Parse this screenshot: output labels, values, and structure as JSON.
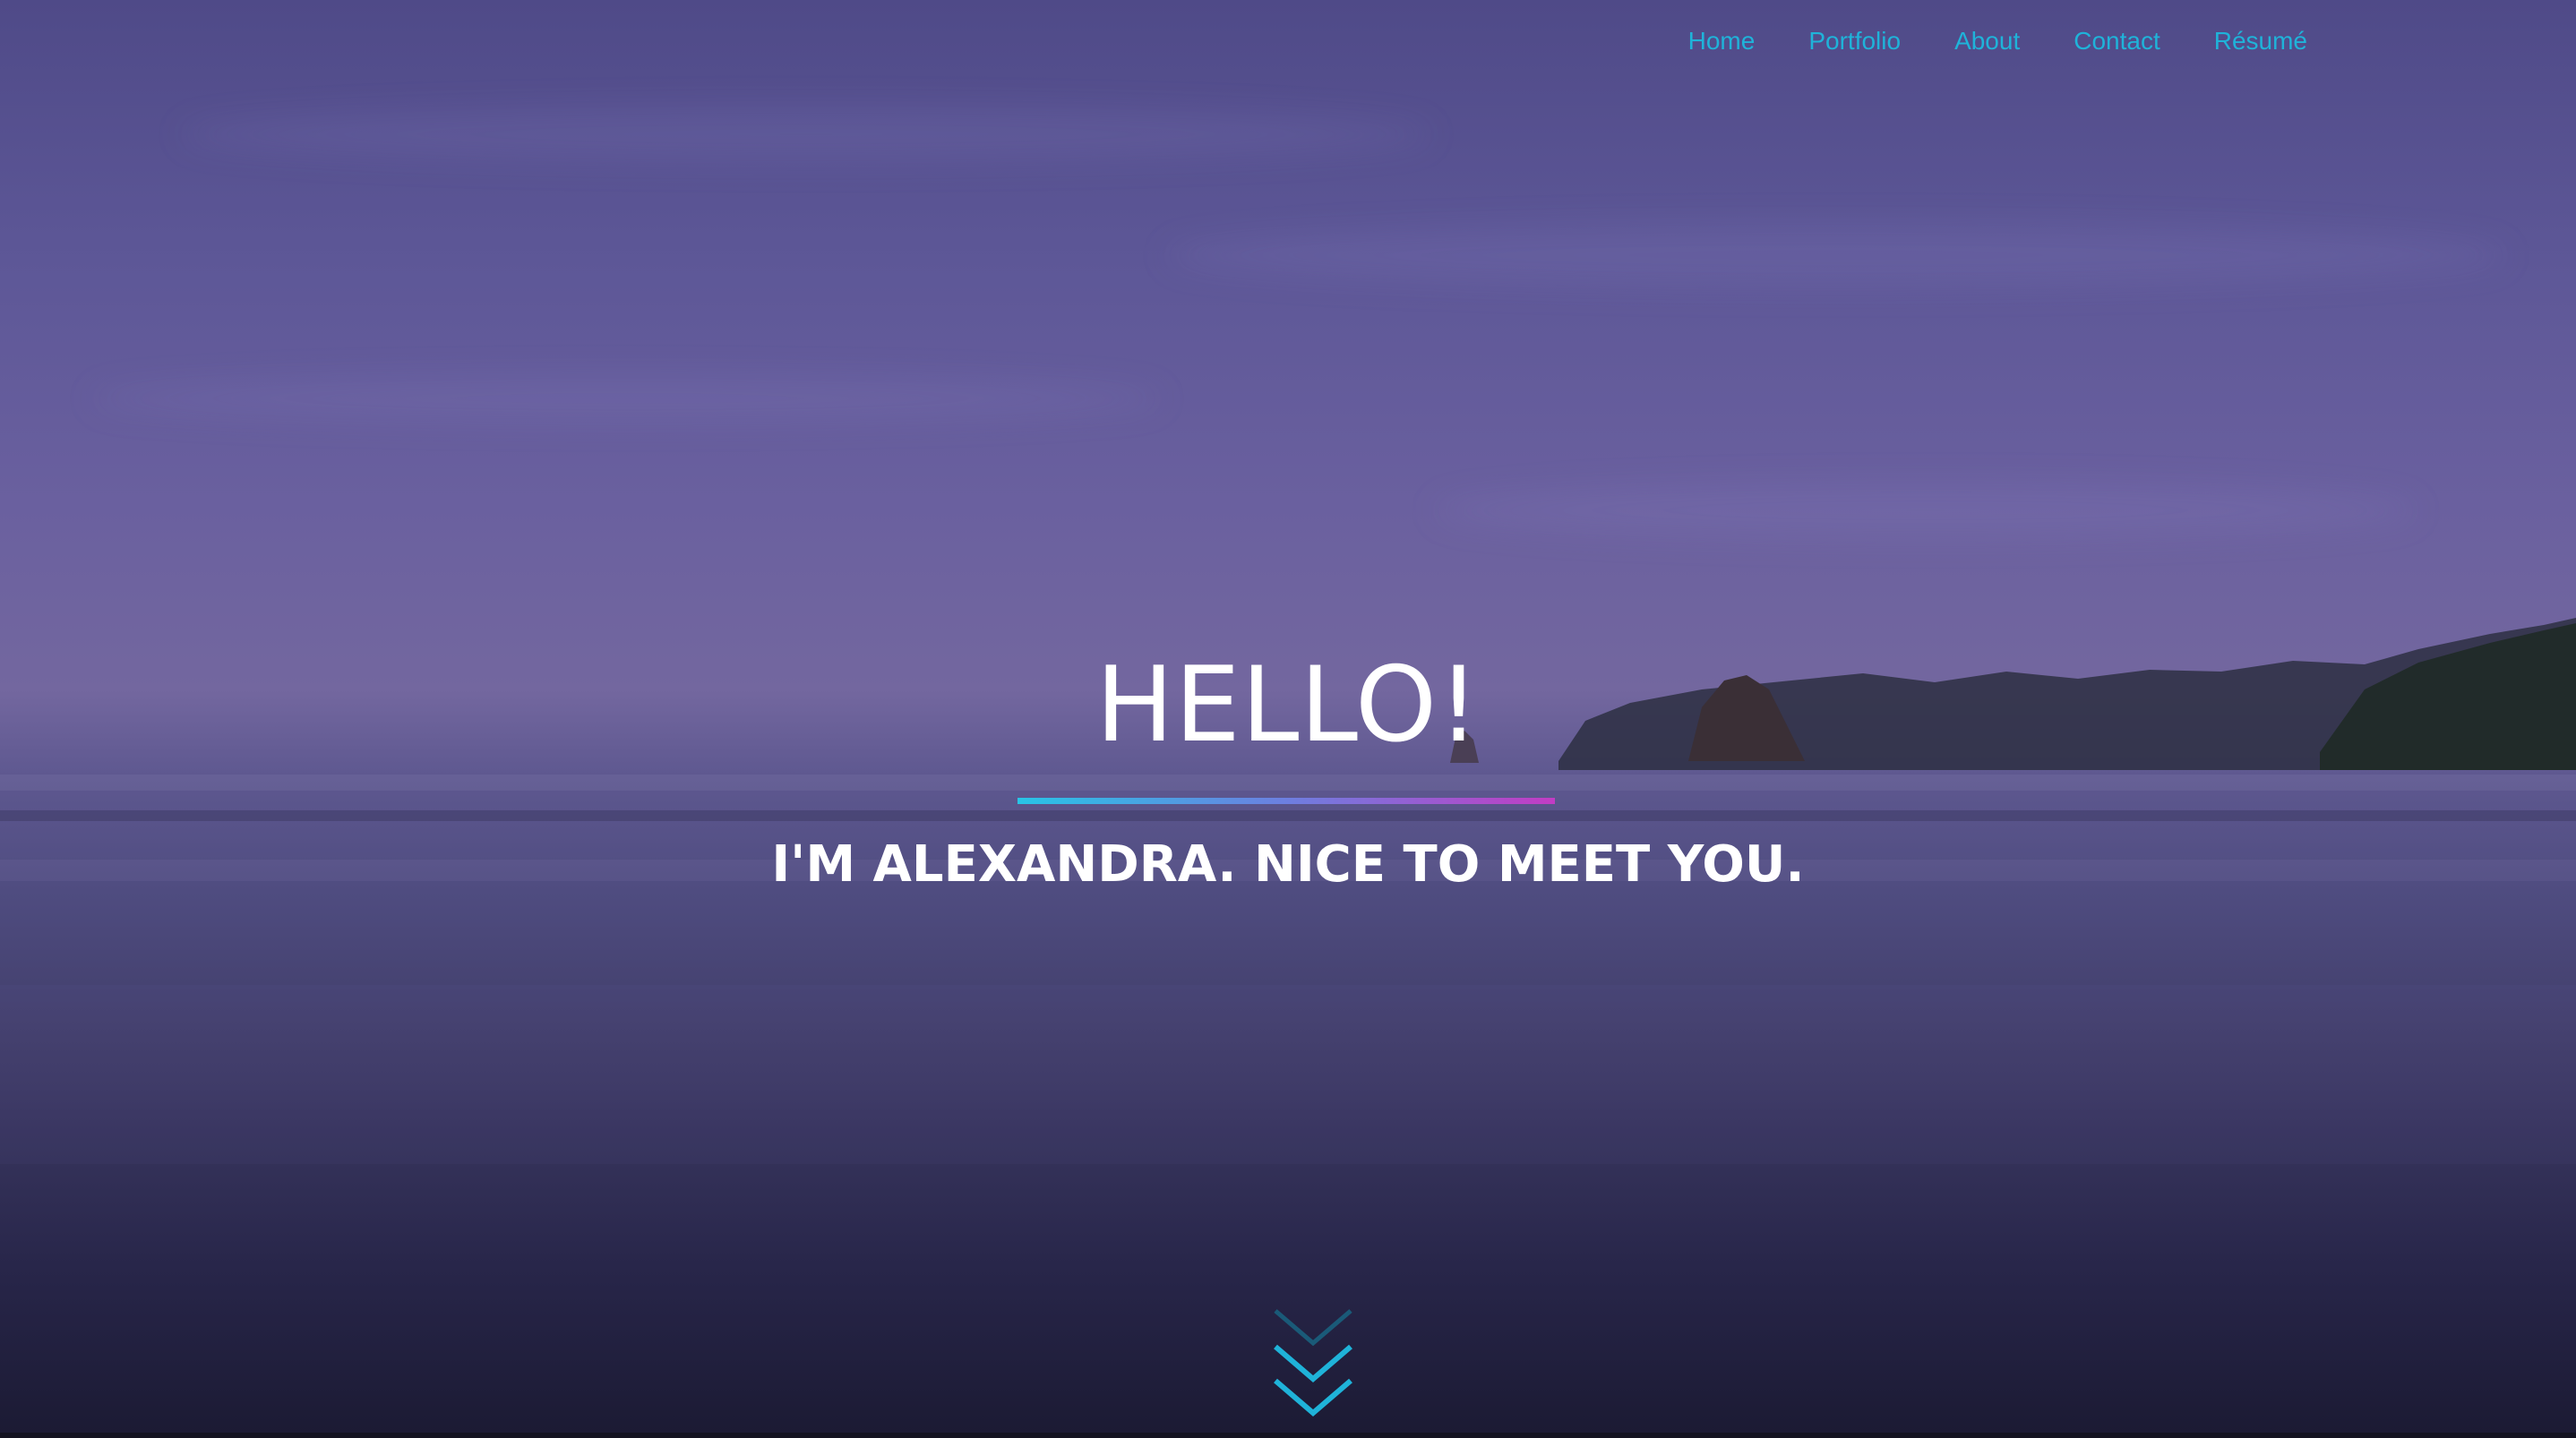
{
  "nav": {
    "items": [
      {
        "label": "Home"
      },
      {
        "label": "Portfolio"
      },
      {
        "label": "About"
      },
      {
        "label": "Contact"
      },
      {
        "label": "Résumé"
      }
    ]
  },
  "hero": {
    "title": "HELLO!",
    "subtitle": "I'M ALEXANDRA. NICE TO MEET YOU."
  },
  "colors": {
    "nav_link": "#1fb3d9",
    "divider_start": "#28c4e6",
    "divider_end": "#c23cc4",
    "arrow": "#1fb3d9"
  },
  "icons": {
    "scroll": "chevron-double-down-icon"
  }
}
